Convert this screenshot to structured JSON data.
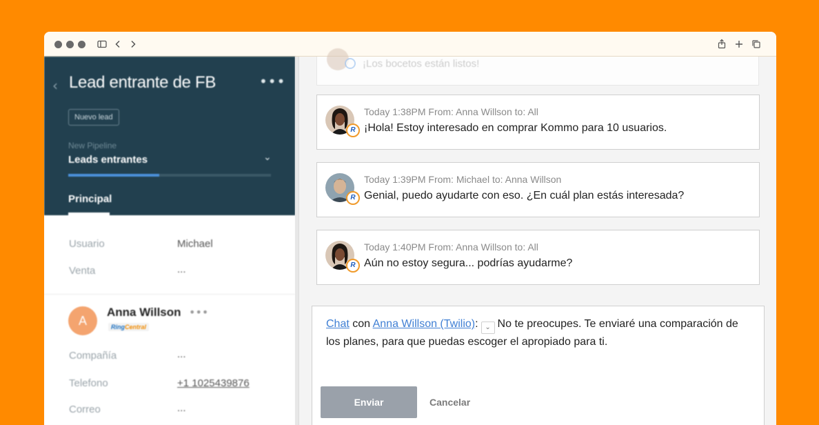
{
  "lead": {
    "title": "Lead entrante de FB",
    "tag": "Nuevo lead",
    "pipeline_label": "New Pipeline",
    "pipeline_value": "Leads entrantes",
    "progress": 0.45,
    "tab": "Principal",
    "fields": [
      {
        "label": "Usuario",
        "value": "Michael"
      },
      {
        "label": "Venta",
        "value": "..."
      }
    ]
  },
  "contact": {
    "initial": "A",
    "name": "Anna Willson",
    "badge_main": "Ring",
    "badge_accent": "Central",
    "fields": [
      {
        "label": "Compañía",
        "value": "..."
      },
      {
        "label": "Telefono",
        "value": "+1 1025439876"
      },
      {
        "label": "Correo",
        "value": "..."
      }
    ]
  },
  "feed": {
    "faded_message": "¡Los bocetos están listos!",
    "messages": [
      {
        "meta": "Today 1:38PM From: Anna Willson to: All",
        "text": "¡Hola! Estoy interesado en comprar Kommo para 10 usuarios.",
        "author": "anna"
      },
      {
        "meta": "Today 1:39PM From: Michael to: Anna Willson",
        "text": "Genial, puedo ayudarte con eso. ¿En cuál plan estás interesada?",
        "author": "michael"
      },
      {
        "meta": "Today 1:40PM From: Anna Willson to: All",
        "text": "Aún no estoy segura... podrías ayudarme?",
        "author": "anna"
      }
    ],
    "badge_letter": "R"
  },
  "composer": {
    "chat_link": "Chat",
    "con": "con",
    "recipient_link": "Anna Willson (Twilio)",
    "colon": ":",
    "text": "No te preocupes. Te enviaré una comparación de los planes, para que puedas escoger el apropiado para ti.",
    "send_label": "Enviar",
    "cancel_label": "Cancelar"
  },
  "colors": {
    "background": "#ff8a00",
    "sidebar": "#22404f",
    "link": "#3f7fd4",
    "send_button": "#9aa1aa"
  }
}
